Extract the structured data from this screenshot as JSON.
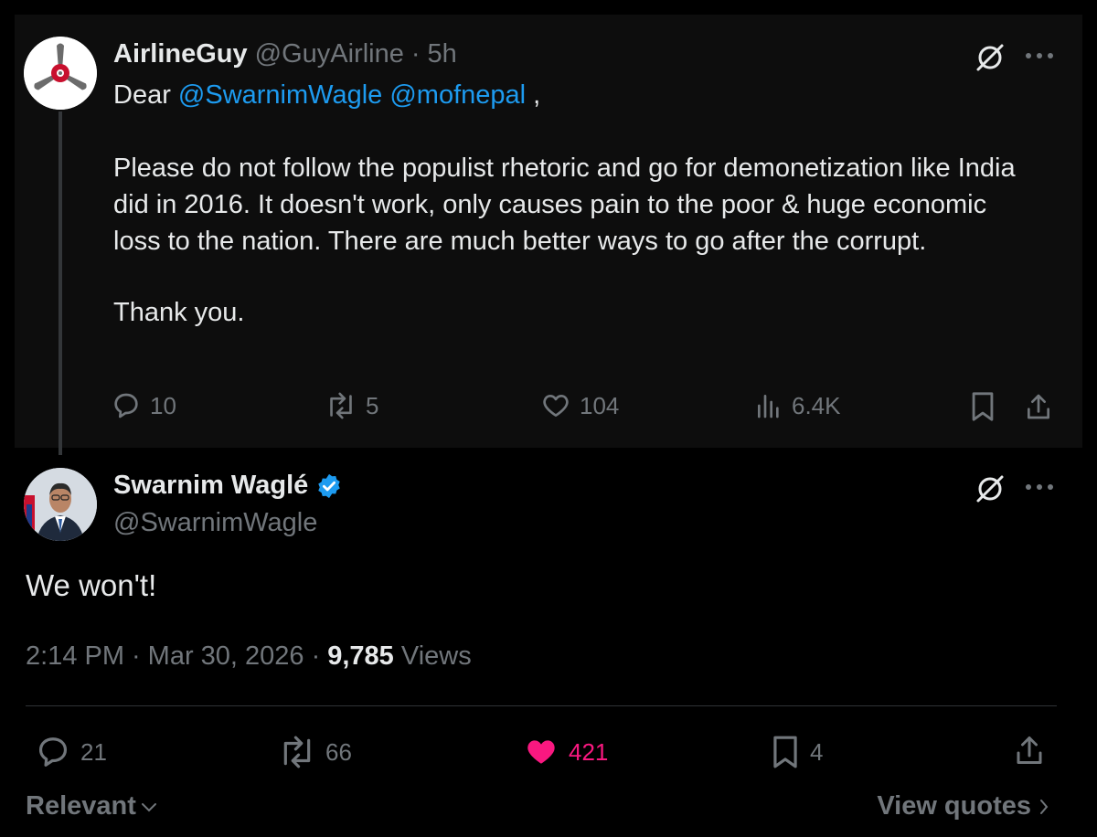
{
  "parent_tweet": {
    "display_name": "AirlineGuy",
    "handle": "@GuyAirline",
    "separator": "·",
    "time": "5h",
    "text_prefix": "Dear ",
    "mention_1": "@SwarnimWagle",
    "mention_2": "@mofnepal",
    "text_after_mentions": " ,",
    "paragraph_1": "Please do not follow the populist rhetoric and go for demonetization like India did in 2016. It doesn't work, only causes pain to the poor & huge economic loss to the nation. There are much better ways to go after the corrupt.",
    "paragraph_2": "Thank you.",
    "replies": "10",
    "reposts": "5",
    "likes": "104",
    "views": "6.4K",
    "avatar_icon": "propeller-logo-icon"
  },
  "reply_tweet": {
    "display_name": "Swarnim Waglé",
    "handle": "@SwarnimWagle",
    "verified": true,
    "text": "We won't!",
    "time": "2:14 PM",
    "date": "Mar 30, 2026",
    "views_count": "9,785",
    "views_label": "Views",
    "replies": "21",
    "reposts": "66",
    "likes": "421",
    "bookmarks": "4",
    "liked": true
  },
  "footer": {
    "sort_label": "Relevant",
    "view_quotes_label": "View quotes"
  },
  "colors": {
    "background": "#000000",
    "parent_background": "#0d0d0d",
    "text": "#e7e9ea",
    "muted": "#71767b",
    "accent": "#1d9bf0",
    "like": "#f91880"
  }
}
